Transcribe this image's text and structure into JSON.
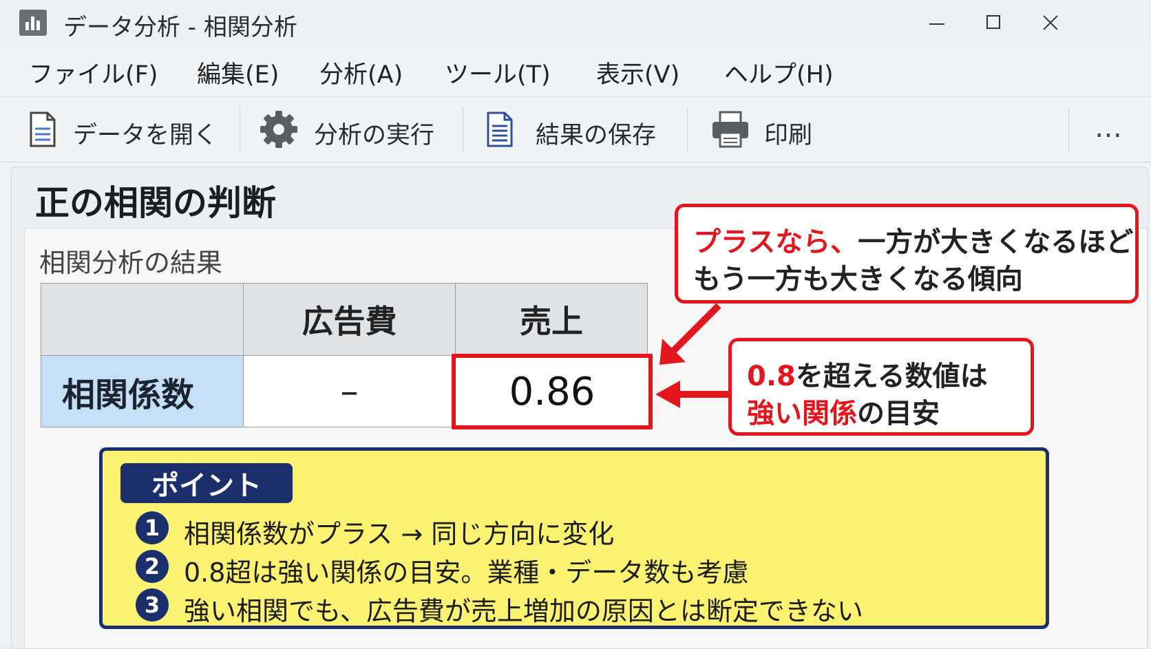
{
  "window": {
    "title": "データ分析 - 相関分析"
  },
  "menu": [
    {
      "label": "ファイル(F)"
    },
    {
      "label": "編集(E)"
    },
    {
      "label": "分析(A)"
    },
    {
      "label": "ツール(T)"
    },
    {
      "label": "表示(V)"
    },
    {
      "label": "ヘルプ(H)"
    }
  ],
  "toolbar": {
    "open_label": "データを開く",
    "run_label": "分析の実行",
    "save_label": "結果の保存",
    "print_label": "印刷",
    "more_label": "…"
  },
  "content": {
    "heading": "正の相関の判断",
    "subheading": "相関分析の結果",
    "table": {
      "headers": [
        "",
        "広告費",
        "売上"
      ],
      "row_label": "相関係数",
      "values": [
        "–",
        "0.86"
      ]
    },
    "callout_top": {
      "line1_red": "プラスなら、",
      "line1_rest": "一方が大きくなるほど",
      "line2": "もう一方も大きくなる傾向"
    },
    "callout_right": {
      "line1_red": "0.8",
      "line1_rest": "を超える数値は",
      "line2_red": "強い関係",
      "line2_rest": "の目安"
    },
    "point": {
      "tag": "ポイント",
      "items": [
        {
          "num": "1",
          "text": "相関係数がプラス → 同じ方向に変化"
        },
        {
          "num": "2",
          "text": "0.8超は強い関係の目安。業種・データ数も考慮"
        },
        {
          "num": "3",
          "text": "強い相関でも、広告費が売上増加の原因とは断定できない"
        }
      ]
    }
  },
  "colors": {
    "accent_red": "#e3161d",
    "navy": "#1a2f6b",
    "highlight_yellow": "#fbf272",
    "row_header_blue": "#c5dff7"
  },
  "icons": {
    "app": "bar-chart-icon",
    "open": "document-icon",
    "run": "gear-icon",
    "save": "document-lines-icon",
    "print": "printer-icon",
    "more": "more-horizontal-icon"
  }
}
